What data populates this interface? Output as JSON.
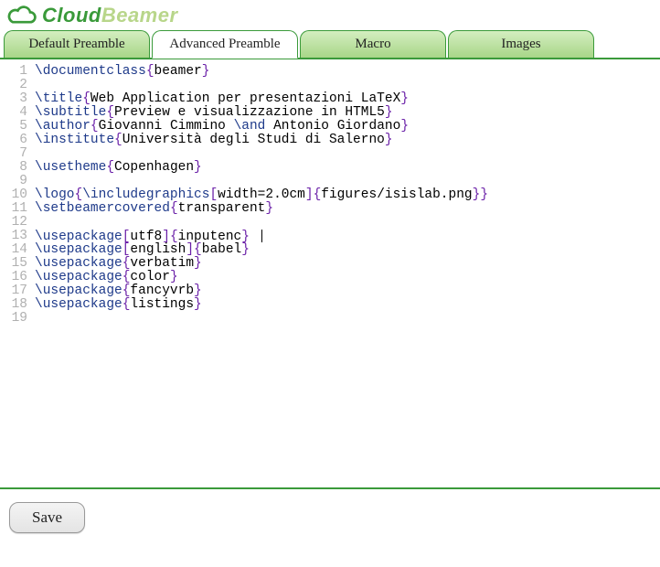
{
  "logo": {
    "main": "Cloud",
    "sub": "Beamer"
  },
  "tabs": [
    {
      "label": "Default Preamble",
      "active": false
    },
    {
      "label": "Advanced Preamble",
      "active": true
    },
    {
      "label": "Macro",
      "active": false
    },
    {
      "label": "Images",
      "active": false
    }
  ],
  "code_lines": [
    {
      "n": 1,
      "parts": [
        [
          "cmd",
          "\\documentclass"
        ],
        [
          "brc",
          "{"
        ],
        [
          "txt",
          "beamer"
        ],
        [
          "brc",
          "}"
        ]
      ]
    },
    {
      "n": 2,
      "parts": []
    },
    {
      "n": 3,
      "parts": [
        [
          "cmd",
          "\\title"
        ],
        [
          "brc",
          "{"
        ],
        [
          "txt",
          "Web Application per presentazioni LaTeX"
        ],
        [
          "brc",
          "}"
        ]
      ]
    },
    {
      "n": 4,
      "parts": [
        [
          "cmd",
          "\\subtitle"
        ],
        [
          "brc",
          "{"
        ],
        [
          "txt",
          "Preview e visualizzazione in HTML5"
        ],
        [
          "brc",
          "}"
        ]
      ]
    },
    {
      "n": 5,
      "parts": [
        [
          "cmd",
          "\\author"
        ],
        [
          "brc",
          "{"
        ],
        [
          "txt",
          "Giovanni Cimmino "
        ],
        [
          "cmd",
          "\\and"
        ],
        [
          "txt",
          " Antonio Giordano"
        ],
        [
          "brc",
          "}"
        ]
      ]
    },
    {
      "n": 6,
      "parts": [
        [
          "cmd",
          "\\institute"
        ],
        [
          "brc",
          "{"
        ],
        [
          "txt",
          "Università degli Studi di Salerno"
        ],
        [
          "brc",
          "}"
        ]
      ]
    },
    {
      "n": 7,
      "parts": []
    },
    {
      "n": 8,
      "parts": [
        [
          "cmd",
          "\\usetheme"
        ],
        [
          "brc",
          "{"
        ],
        [
          "txt",
          "Copenhagen"
        ],
        [
          "brc",
          "}"
        ]
      ]
    },
    {
      "n": 9,
      "parts": []
    },
    {
      "n": 10,
      "parts": [
        [
          "cmd",
          "\\logo"
        ],
        [
          "brc",
          "{"
        ],
        [
          "cmd",
          "\\includegraphics"
        ],
        [
          "brk",
          "["
        ],
        [
          "txt",
          "width=2.0cm"
        ],
        [
          "brk",
          "]"
        ],
        [
          "brc",
          "{"
        ],
        [
          "txt",
          "figures/isislab.png"
        ],
        [
          "brc",
          "}"
        ],
        [
          "brc",
          "}"
        ]
      ]
    },
    {
      "n": 11,
      "parts": [
        [
          "cmd",
          "\\setbeamercovered"
        ],
        [
          "brc",
          "{"
        ],
        [
          "txt",
          "transparent"
        ],
        [
          "brc",
          "}"
        ]
      ]
    },
    {
      "n": 12,
      "parts": []
    },
    {
      "n": 13,
      "parts": [
        [
          "cmd",
          "\\usepackage"
        ],
        [
          "brk",
          "["
        ],
        [
          "txt",
          "utf8"
        ],
        [
          "brk",
          "]"
        ],
        [
          "brc",
          "{"
        ],
        [
          "txt",
          "inputenc"
        ],
        [
          "brc",
          "}"
        ]
      ],
      "cursor": true
    },
    {
      "n": 14,
      "parts": [
        [
          "cmd",
          "\\usepackage"
        ],
        [
          "brk",
          "["
        ],
        [
          "txt",
          "english"
        ],
        [
          "brk",
          "]"
        ],
        [
          "brc",
          "{"
        ],
        [
          "txt",
          "babel"
        ],
        [
          "brc",
          "}"
        ]
      ]
    },
    {
      "n": 15,
      "parts": [
        [
          "cmd",
          "\\usepackage"
        ],
        [
          "brc",
          "{"
        ],
        [
          "txt",
          "verbatim"
        ],
        [
          "brc",
          "}"
        ]
      ]
    },
    {
      "n": 16,
      "parts": [
        [
          "cmd",
          "\\usepackage"
        ],
        [
          "brc",
          "{"
        ],
        [
          "txt",
          "color"
        ],
        [
          "brc",
          "}"
        ]
      ]
    },
    {
      "n": 17,
      "parts": [
        [
          "cmd",
          "\\usepackage"
        ],
        [
          "brc",
          "{"
        ],
        [
          "txt",
          "fancyvrb"
        ],
        [
          "brc",
          "}"
        ]
      ]
    },
    {
      "n": 18,
      "parts": [
        [
          "cmd",
          "\\usepackage"
        ],
        [
          "brc",
          "{"
        ],
        [
          "txt",
          "listings"
        ],
        [
          "brc",
          "}"
        ]
      ]
    },
    {
      "n": 19,
      "parts": []
    }
  ],
  "footer": {
    "save_label": "Save"
  }
}
